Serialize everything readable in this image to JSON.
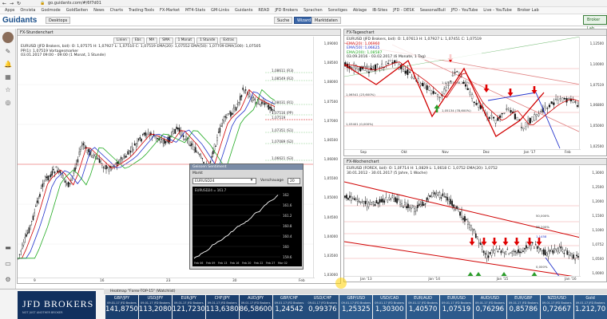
{
  "browser": {
    "url": "go.guidants.com/#/6f7d01",
    "bookmarks": [
      "Apps",
      "Onvista",
      "Godmode",
      "GoldSeiten",
      "News",
      "Charts",
      "Trading-Tools",
      "FX-Market",
      "MT4-Stats",
      "GM-Links",
      "Guidants",
      "READ",
      "JFD Brokers",
      "Sprachen",
      "Sonstiges",
      "Ablage",
      "IB-Sites",
      "JFD - DESK",
      "SeasonalBull",
      "JFD - YouTube",
      "Live - YouTube",
      "Broker Lab"
    ]
  },
  "toolbar": {
    "logo": "Guidants",
    "buttons": [
      "Desktops",
      "Suche",
      "Wizard",
      "Marktdaten"
    ],
    "trade_action": "Broker Lab"
  },
  "hourly": {
    "title": "FX-Stundenchart",
    "legend": [
      "EURUSD (JFD Brokers, bid): O: 1,07575  H: 1,07927  L: 1,07510  C: 1,07519  EMA(20): 1,07552  EMA(50): 1,07709  EMA(100): 1,07505",
      "PP(1): 1,07519  Vortagesmarker",
      "03.01.2017 09:00 - 09:00 (1 Monat, 1 Stunde)"
    ],
    "controls": [
      "Linien",
      "Ebs",
      "MA",
      "SMA",
      "1 Monat",
      "1 Stunde",
      "Extras"
    ],
    "levels": [
      {
        "label": "1,08611 (R3)",
        "value": 1.08611
      },
      {
        "label": "1,08549 (R2)",
        "value": 1.08549
      },
      {
        "label": "1,08031 (R1)",
        "value": 1.08031
      },
      {
        "label": "1,07516 (PP)",
        "value": 1.07516
      },
      {
        "label": "1,07519",
        "value": 1.07519
      },
      {
        "label": "1,07351 (S1)",
        "value": 1.07351
      },
      {
        "label": "1,07089 (S2)",
        "value": 1.07089
      },
      {
        "label": "1,06621 (S3)",
        "value": 1.06621
      }
    ],
    "yticks": [
      "1,09000",
      "1,08500",
      "1,08000",
      "1,07500",
      "1,07000",
      "1,06500",
      "1,06000",
      "1,05500",
      "1,05000",
      "1,04500",
      "1,04000",
      "1,03500",
      "1,03000"
    ],
    "xticks": [
      "9",
      "16",
      "23",
      "30",
      "Feb"
    ]
  },
  "popup": {
    "title": "Geissen Sentiment",
    "tab": "Markt",
    "symbol": "EURUSD24",
    "horizon_label": "Vorschauage",
    "horizon_value": "20",
    "series_label": "EURUSD24 = 161.7",
    "yticks": [
      "162",
      "161.6",
      "161.2",
      "160.8",
      "160.4",
      "160",
      "159.6"
    ],
    "xticks": [
      "Feb 06",
      "Feb 09",
      "Feb 13",
      "Feb 16",
      "Feb 20",
      "Feb 22",
      "Feb 27",
      "Mar 02"
    ]
  },
  "daily": {
    "title": "FX-Tageschart",
    "legend": [
      "EURUSD (JFD Brokers, bid): O: 1,07613  H: 1,07927  L: 1,07451  C: 1,07519",
      "EMA(20): 1,06960",
      "EMA(50): 1,06625",
      "EMA(200): 1,08587",
      "03.09.2016 - 03.02.2017 (6 Monate, 1 Tag)"
    ],
    "yticks": [
      "1,12500",
      "1,10000",
      "1,07519",
      "1,06800",
      "1,05000",
      "1,02500"
    ],
    "xticks": [
      "Sep",
      "Okt",
      "Nov",
      "Dez",
      "Jan '17",
      "Feb"
    ],
    "annotations": [
      "1,10348 (61,800%)",
      "1,07403 (38,200%)",
      "1,06541 (23,600%)",
      "1,05134 (78,600%)",
      "1,03401 (0,000%)"
    ]
  },
  "weekly": {
    "title": "FX-Wochenchart",
    "legend": [
      "EURUSD (FOREX, bid): O: 1,0F714  H: 1,0829  L: 1,0618  C: 1,0752  EMA(20): 1,0752",
      "30.01.2012 - 30.01.2017 (5 Jahre, 1 Woche)"
    ],
    "yticks": [
      "1,3000",
      "1,2500",
      "1,2000",
      "1,1500",
      "1,1000",
      "1,0752",
      "1,0500",
      "1,0000"
    ],
    "xticks": [
      "Jan '13",
      "Jan '14",
      "Jan '15",
      "Jan '16"
    ],
    "annotations": [
      "1,1458",
      "50,000%",
      "38,200%",
      "0,000%"
    ]
  },
  "bottom": {
    "brand": "JFD BROKERS",
    "tagline": "NOT JUST ANOTHER BROKER",
    "heatmap_title": "Heatmap \"Forex-TOP-15\" (Watchlist)",
    "tiles": [
      {
        "name": "GBP/JPY",
        "price": "141,87500",
        "color": "#1b3f6e"
      },
      {
        "name": "USD/JPY",
        "price": "113,20800",
        "color": "#1b3f6e"
      },
      {
        "name": "EUR/JPY",
        "price": "121,72300",
        "color": "#1b3f6e"
      },
      {
        "name": "CHF/JPY",
        "price": "113,63800",
        "color": "#1b3f6e"
      },
      {
        "name": "AUD/JPY",
        "price": "86,58600",
        "color": "#1b3f6e"
      },
      {
        "name": "GBP/CHF",
        "price": "1,24542",
        "color": "#244d7c"
      },
      {
        "name": "USD/CHF",
        "price": "0,99376",
        "color": "#244d7c"
      },
      {
        "name": "GBP/USD",
        "price": "1,25325",
        "color": "#2c5a8c"
      },
      {
        "name": "USD/CAD",
        "price": "1,30300",
        "color": "#2c5a8c"
      },
      {
        "name": "EUR/AUD",
        "price": "1,40570",
        "color": "#2c5a8c"
      },
      {
        "name": "EUR/USD",
        "price": "1,07519",
        "color": "#2c5a8c"
      },
      {
        "name": "AUD/USD",
        "price": "0,76296",
        "color": "#2c5a8c"
      },
      {
        "name": "EUR/GBP",
        "price": "0,85786",
        "color": "#2c5a8c"
      },
      {
        "name": "NZD/USD",
        "price": "0,72667",
        "color": "#2c5a8c"
      },
      {
        "name": "Gold",
        "price": "1.212,70",
        "color": "#2c5a8c"
      }
    ],
    "tile_sub": "09.01.17 JFD Brokers"
  },
  "colors": {
    "up_arrow": "#2a9d2a",
    "down_arrow": "#e00000",
    "ema20": "#d00000",
    "ema50": "#2233cc",
    "ema100": "#22aa22"
  }
}
